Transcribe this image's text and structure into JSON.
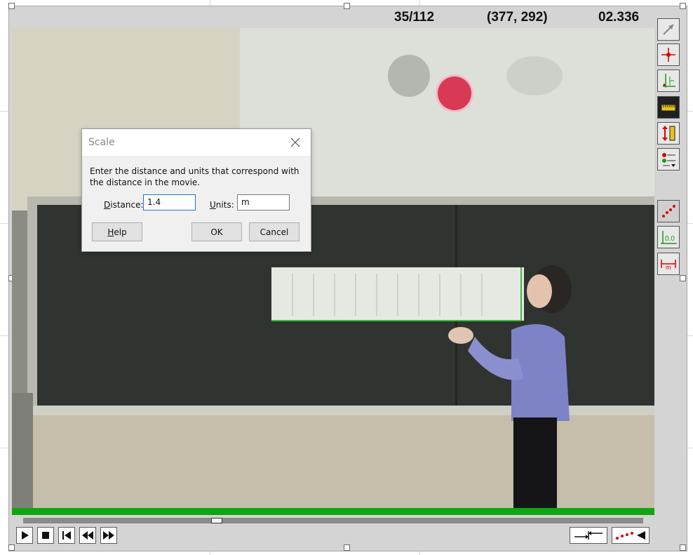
{
  "readout": {
    "frame": "35/112",
    "cursor": "(377, 292)",
    "time": "02.336"
  },
  "video_scene": {
    "ball_color": "#d83a55"
  },
  "playback": {
    "progress_color": "#12a412",
    "buttons": [
      "play-icon",
      "stop-icon",
      "step-to-start-icon",
      "step-back-icon",
      "step-forward-icon"
    ]
  },
  "toolbar": {
    "tools": [
      "pointer-arrow-icon",
      "crosshair-point-icon",
      "set-origin-axes-icon",
      "ruler-icon",
      "scale-vertical-ruler-icon",
      "point-series-menu-icon",
      "show-trail-icon",
      "coordinate-display-icon",
      "measure-distance-icon"
    ],
    "bottom_right": [
      "zoom-fit-icon",
      "trail-toggle-icon"
    ]
  },
  "dialog": {
    "title": "Scale",
    "message": "Enter the distance and units that correspond with the distance in the movie.",
    "distance_label_mnemonic": "D",
    "distance_label_rest": "istance:",
    "distance_value": "1.4",
    "units_label_mnemonic": "U",
    "units_label_rest": "nits:",
    "units_value": "m",
    "help_mnemonic": "H",
    "help_rest": "elp",
    "ok_label": "OK",
    "cancel_label": "Cancel"
  }
}
